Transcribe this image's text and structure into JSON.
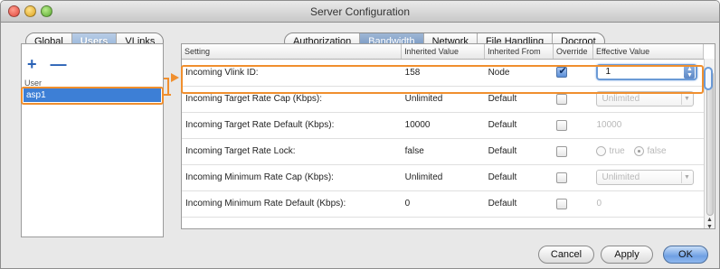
{
  "window": {
    "title": "Server Configuration"
  },
  "scope_tabs": [
    "Global",
    "Users",
    "VLinks"
  ],
  "scope_selected": "Users",
  "section_tabs": [
    "Authorization",
    "Bandwidth",
    "Network",
    "File Handling",
    "Docroot"
  ],
  "section_selected": "Bandwidth",
  "users_panel": {
    "add_label": "+",
    "remove_label": "—",
    "column_header": "User",
    "users": [
      "asp1"
    ]
  },
  "table": {
    "headers": [
      "Setting",
      "Inherited Value",
      "Inherited From",
      "Override",
      "Effective Value"
    ],
    "rows": [
      {
        "setting": "Incoming Vlink ID:",
        "inherited_value": "158",
        "inherited_from": "Node",
        "override": true,
        "effective_kind": "stepper",
        "effective": "1"
      },
      {
        "setting": "Incoming Target Rate Cap (Kbps):",
        "inherited_value": "Unlimited",
        "inherited_from": "Default",
        "override": false,
        "effective_kind": "combo",
        "effective": "Unlimited"
      },
      {
        "setting": "Incoming Target Rate Default (Kbps):",
        "inherited_value": "10000",
        "inherited_from": "Default",
        "override": false,
        "effective_kind": "text",
        "effective": "10000"
      },
      {
        "setting": "Incoming Target Rate Lock:",
        "inherited_value": "false",
        "inherited_from": "Default",
        "override": false,
        "effective_kind": "radio",
        "radio_true": "true",
        "radio_false": "false",
        "effective": "false"
      },
      {
        "setting": "Incoming Minimum Rate Cap (Kbps):",
        "inherited_value": "Unlimited",
        "inherited_from": "Default",
        "override": false,
        "effective_kind": "combo",
        "effective": "Unlimited"
      },
      {
        "setting": "Incoming Minimum Rate Default (Kbps):",
        "inherited_value": "0",
        "inherited_from": "Default",
        "override": false,
        "effective_kind": "text",
        "effective": "0"
      }
    ]
  },
  "buttons": {
    "cancel": "Cancel",
    "apply": "Apply",
    "ok": "OK"
  },
  "colors": {
    "highlight": "#f08f2e",
    "selection": "#3d7fd6"
  }
}
